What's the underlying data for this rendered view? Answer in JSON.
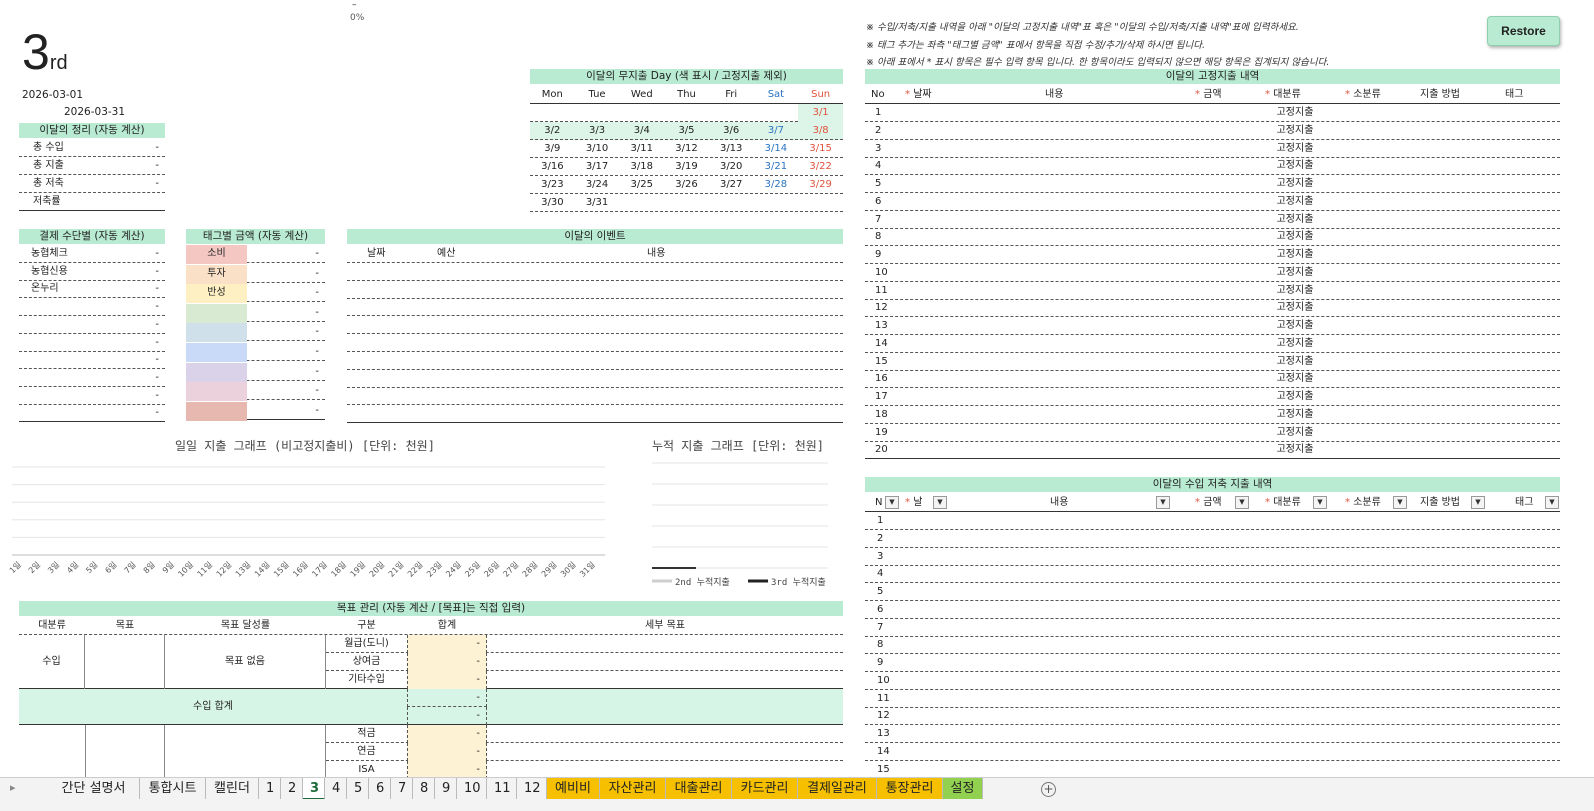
{
  "top_progress": {
    "dash": "–",
    "percent": "0%"
  },
  "title": {
    "number": "3",
    "suffix": "rd"
  },
  "dates": {
    "start": "2026-03-01",
    "end": "2026-03-31"
  },
  "summary": {
    "header": "이달의 정리 (자동 계산)",
    "rows": [
      {
        "label": "총 수입",
        "value": "-"
      },
      {
        "label": "총 지출",
        "value": "-"
      },
      {
        "label": "총 저축",
        "value": "-"
      },
      {
        "label": "저축률",
        "value": ""
      }
    ]
  },
  "calendar": {
    "header": "이달의 무지출  Day (색 표시 / 고정지출 제외)",
    "days": [
      "Mon",
      "Tue",
      "Wed",
      "Thu",
      "Fri",
      "Sat",
      "Sun"
    ],
    "weeks": [
      [
        "",
        "",
        "",
        "",
        "",
        "",
        "3/1"
      ],
      [
        "3/2",
        "3/3",
        "3/4",
        "3/5",
        "3/6",
        "3/7",
        "3/8"
      ],
      [
        "3/9",
        "3/10",
        "3/11",
        "3/12",
        "3/13",
        "3/14",
        "3/15"
      ],
      [
        "3/16",
        "3/17",
        "3/18",
        "3/19",
        "3/20",
        "3/21",
        "3/22"
      ],
      [
        "3/23",
        "3/24",
        "3/25",
        "3/26",
        "3/27",
        "3/28",
        "3/29"
      ],
      [
        "3/30",
        "3/31",
        "",
        "",
        "",
        "",
        ""
      ]
    ]
  },
  "payment": {
    "header": "결제 수단별 (자동 계산)",
    "rows": [
      {
        "label": "농협체크",
        "value": "-"
      },
      {
        "label": "농협신용",
        "value": "-"
      },
      {
        "label": "온누리",
        "value": "-"
      },
      {
        "label": "",
        "value": "-"
      },
      {
        "label": "",
        "value": "-"
      },
      {
        "label": "",
        "value": "-"
      },
      {
        "label": "",
        "value": "-"
      },
      {
        "label": "",
        "value": "-"
      },
      {
        "label": "",
        "value": "-"
      },
      {
        "label": "",
        "value": "-"
      }
    ]
  },
  "tags": {
    "header": "태그별 금액 (자동 계산)",
    "rows": [
      {
        "label": "소비",
        "value": "-",
        "color": "#f4c7c3"
      },
      {
        "label": "투자",
        "value": "-",
        "color": "#fbe0c8"
      },
      {
        "label": "반성",
        "value": "-",
        "color": "#fff0c4"
      },
      {
        "label": "",
        "value": "-",
        "color": "#d9ead3"
      },
      {
        "label": "",
        "value": "-",
        "color": "#d0e0ea"
      },
      {
        "label": "",
        "value": "-",
        "color": "#c9daf8"
      },
      {
        "label": "",
        "value": "-",
        "color": "#d9d2e9"
      },
      {
        "label": "",
        "value": "-",
        "color": "#ead1dc"
      },
      {
        "label": "",
        "value": "-",
        "color": "#e6b8af"
      }
    ]
  },
  "events": {
    "header": "이달의 이벤트",
    "cols": [
      "날짜",
      "예산",
      "내용"
    ]
  },
  "notes": [
    "※ 수입/저축/지출 내역을 아래 \"이달의 고정지출 내역\"표 혹은 \"이달의 수입/저축/지출 내역\"표에 입력하세요.",
    "※ 태그 추가는 좌측 \"태그별 금액\" 표에서 항목을 직접 수정/추가/삭제 하시면 됩니다.",
    "※ 아래 표에서  *  표시 항목은 필수 입력 항목 입니다. 한 항목이라도 입력되지 않으면 해당 항목은 집계되지 않습니다."
  ],
  "restore_label": "Restore",
  "fixed": {
    "header": "이달의 고정지출 내역",
    "cols": [
      "No",
      "날짜",
      "내용",
      "금액",
      "대분류",
      "소분류",
      "지출 방법",
      "태그"
    ],
    "category_value": "고정지출",
    "count": [
      "1",
      "2",
      "3",
      "4",
      "5",
      "6",
      "7",
      "8",
      "9",
      "10",
      "11",
      "12",
      "13",
      "14",
      "15",
      "16",
      "17",
      "18",
      "19",
      "20"
    ]
  },
  "income": {
    "header": "이달의 수입 저축 지출 내역",
    "cols": [
      "N",
      "날",
      "내용",
      "금액",
      "대분류",
      "소분류",
      "지출 방법",
      "태그"
    ],
    "count": [
      "1",
      "2",
      "3",
      "4",
      "5",
      "6",
      "7",
      "8",
      "9",
      "10",
      "11",
      "12",
      "13",
      "14",
      "15"
    ]
  },
  "daily_chart": {
    "title": "일일 지출 그래프 (비고정지출비) [단위: 천원]",
    "day_suffix": "일"
  },
  "cumulative_chart": {
    "title": "누적 지출 그래프 [단위: 천원]",
    "legend": [
      "2nd 누적지출",
      "3rd 누적지출"
    ]
  },
  "chart_data": [
    {
      "type": "bar",
      "categories": [
        "1일",
        "2일",
        "3일",
        "4일",
        "5일",
        "6일",
        "7일",
        "8일",
        "9일",
        "10일",
        "11일",
        "12일",
        "13일",
        "14일",
        "15일",
        "16일",
        "17일",
        "18일",
        "19일",
        "20일",
        "21일",
        "22일",
        "23일",
        "24일",
        "25일",
        "26일",
        "27일",
        "28일",
        "29일",
        "30일",
        "31일"
      ],
      "values": [
        0,
        0,
        0,
        0,
        0,
        0,
        0,
        0,
        0,
        0,
        0,
        0,
        0,
        0,
        0,
        0,
        0,
        0,
        0,
        0,
        0,
        0,
        0,
        0,
        0,
        0,
        0,
        0,
        0,
        0,
        0
      ],
      "title": "일일 지출 그래프 (비고정지출비) [단위: 천원]",
      "grid": true
    },
    {
      "type": "line",
      "series": [
        {
          "name": "2nd 누적지출",
          "values": []
        },
        {
          "name": "3rd 누적지출",
          "values": []
        }
      ],
      "title": "누적 지출 그래프 [단위: 천원]",
      "legend": "bottom",
      "grid": true
    }
  ],
  "goals": {
    "header": "목표 관리 (자동 계산 / [목표]는 직접 입력)",
    "cols": [
      "대분류",
      "목표",
      "목표 달성률",
      "구분",
      "합계",
      "세부 목표"
    ],
    "income_label": "수입",
    "no_goal": "목표 없음",
    "income_items": [
      {
        "label": "월급(도니)",
        "value": "-"
      },
      {
        "label": "상여금",
        "value": "-"
      },
      {
        "label": "기타수입",
        "value": "-"
      }
    ],
    "income_total_label": "수입 합계",
    "income_total_values": [
      "-",
      "-"
    ],
    "saving_items": [
      {
        "label": "적금",
        "value": "-"
      },
      {
        "label": "연금",
        "value": "-"
      },
      {
        "label": "ISA",
        "value": "-"
      }
    ]
  },
  "sheet_tabs": [
    {
      "label": "간단 설명서",
      "style": ""
    },
    {
      "label": "통합시트",
      "style": ""
    },
    {
      "label": "캘린더",
      "style": ""
    },
    {
      "label": "1",
      "style": ""
    },
    {
      "label": "2",
      "style": ""
    },
    {
      "label": "3",
      "style": "active"
    },
    {
      "label": "4",
      "style": ""
    },
    {
      "label": "5",
      "style": ""
    },
    {
      "label": "6",
      "style": ""
    },
    {
      "label": "7",
      "style": ""
    },
    {
      "label": "8",
      "style": ""
    },
    {
      "label": "9",
      "style": ""
    },
    {
      "label": "10",
      "style": ""
    },
    {
      "label": "11",
      "style": ""
    },
    {
      "label": "12",
      "style": ""
    },
    {
      "label": "예비비",
      "style": "orange"
    },
    {
      "label": "자산관리",
      "style": "orange"
    },
    {
      "label": "대출관리",
      "style": "orange"
    },
    {
      "label": "카드관리",
      "style": "orange"
    },
    {
      "label": "결제일관리",
      "style": "orange"
    },
    {
      "label": "통장관리",
      "style": "orange"
    },
    {
      "label": "설정",
      "style": "green"
    }
  ],
  "add_sheet_symbol": "+",
  "scroll_arrow": "▸"
}
